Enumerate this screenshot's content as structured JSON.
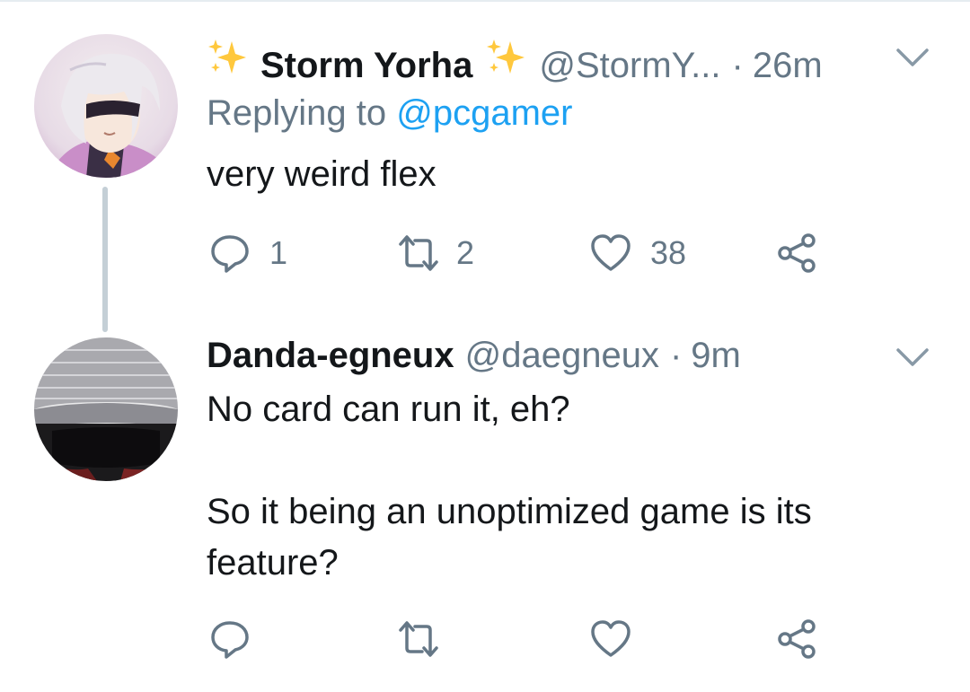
{
  "tweets": [
    {
      "display_name": "Storm Yorha",
      "display_name_emoji": "sparkles-emoji",
      "handle": "@StormY...",
      "separator": "·",
      "time": "26m",
      "replying_label": "Replying to",
      "replying_to": "@pcgamer",
      "text": "very weird flex",
      "counts": {
        "reply": "1",
        "retweet": "2",
        "like": "38"
      }
    },
    {
      "display_name": "Danda-egneux",
      "handle": "@daegneux",
      "separator": "·",
      "time": "9m",
      "text": "No card can run it, eh?\n\nSo it being an unoptimized game is its feature?",
      "counts": {
        "reply": "",
        "retweet": "",
        "like": ""
      }
    }
  ],
  "colors": {
    "text": "#14171a",
    "secondary": "#657786",
    "accent": "#1da1f2",
    "sparkle": "#ffc83d",
    "thread_line": "#c4cfd6"
  },
  "icons": [
    "reply-icon",
    "retweet-icon",
    "like-icon",
    "share-icon",
    "chevron-down-icon",
    "sparkles-emoji"
  ]
}
